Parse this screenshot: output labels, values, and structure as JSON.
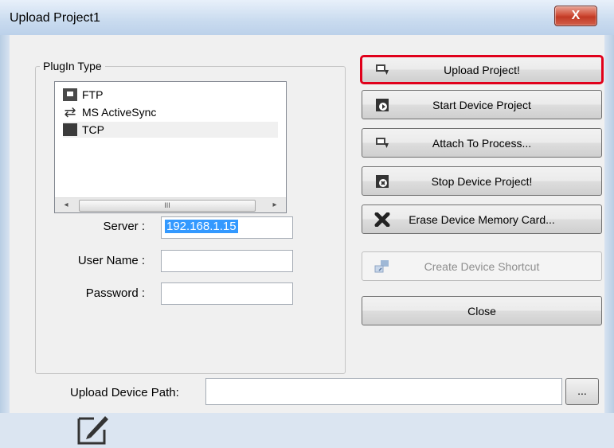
{
  "window": {
    "title": "Upload Project1",
    "close_glyph": "X"
  },
  "plugin_group": {
    "legend": "PlugIn Type",
    "items": [
      {
        "label": "FTP",
        "icon": "ftp-icon"
      },
      {
        "label": "MS ActiveSync",
        "icon": "sync-icon"
      },
      {
        "label": "TCP",
        "icon": "tcp-icon",
        "selected": true
      }
    ],
    "scroll_left": "◂",
    "scroll_right": "▸",
    "scroll_thumb": "III"
  },
  "fields": {
    "server_label": "Server :",
    "server_value": "192.168.1.15",
    "username_label": "User Name :",
    "username_value": "",
    "password_label": "Password :",
    "password_value": ""
  },
  "buttons": {
    "upload": "Upload Project!",
    "start": "Start Device Project",
    "attach": "Attach To Process...",
    "stop": "Stop Device Project!",
    "erase": "Erase Device Memory Card...",
    "shortcut": "Create Device Shortcut",
    "close": "Close"
  },
  "path": {
    "label": "Upload Device Path:",
    "value": "",
    "browse": "..."
  },
  "colors": {
    "highlight": "#e0001b",
    "selection": "#3399ff"
  }
}
